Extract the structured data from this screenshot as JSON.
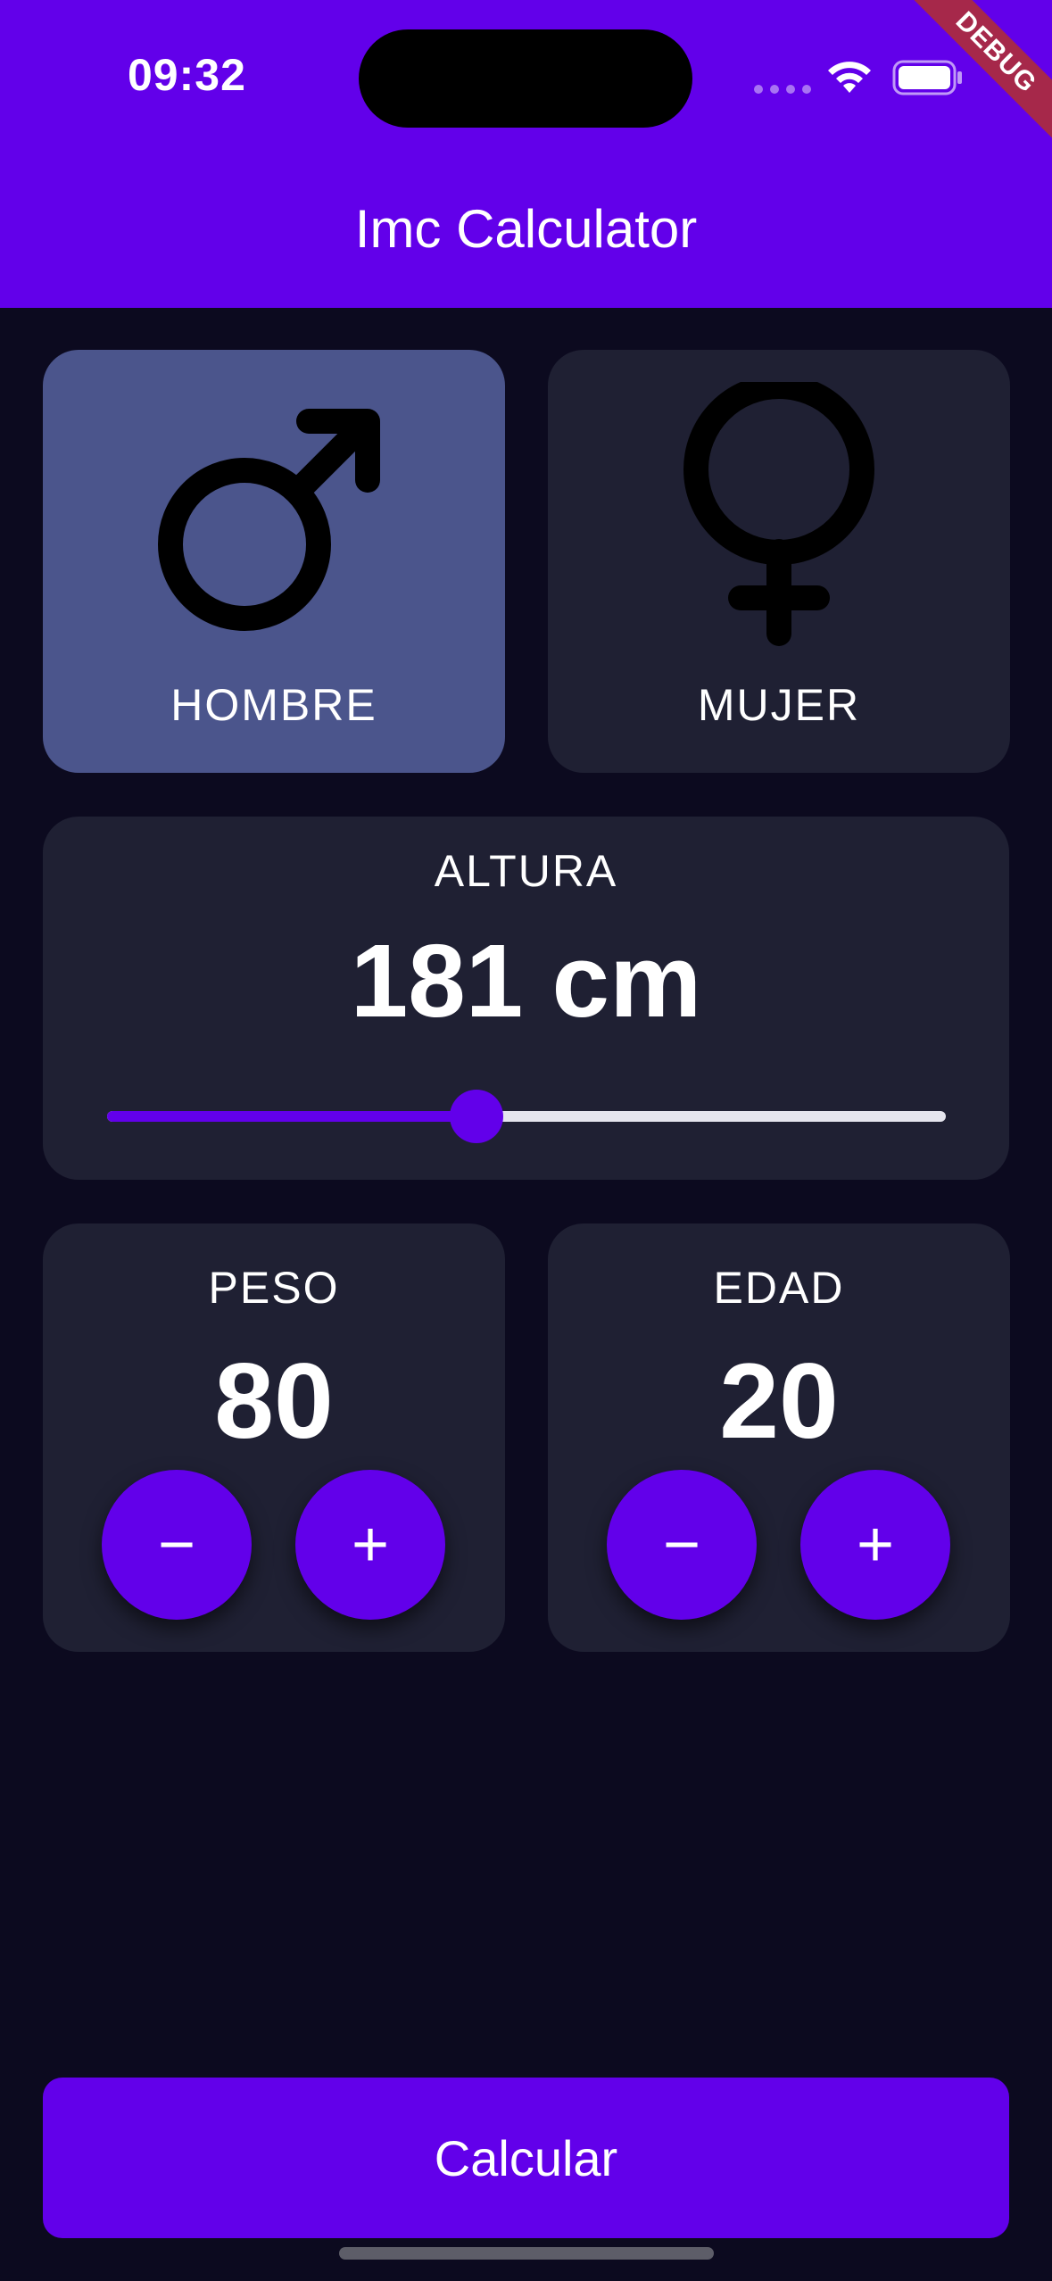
{
  "status_bar": {
    "time": "09:32",
    "debug_label": "DEBUG"
  },
  "app_bar": {
    "title": "Imc Calculator"
  },
  "gender": {
    "male": {
      "label": "HOMBRE",
      "icon": "male-icon",
      "selected": true
    },
    "female": {
      "label": "MUJER",
      "icon": "female-icon",
      "selected": false
    }
  },
  "height": {
    "label": "ALTURA",
    "value_text": "181 cm",
    "slider_fraction": 0.44
  },
  "weight": {
    "label": "PESO",
    "value": "80",
    "minus_label": "−",
    "plus_label": "+"
  },
  "age": {
    "label": "EDAD",
    "value": "20",
    "minus_label": "−",
    "plus_label": "+"
  },
  "calculate_button": {
    "label": "Calcular"
  },
  "colors": {
    "accent": "#6200ea",
    "background": "#0c0a1f",
    "card": "#1f2033",
    "card_selected": "#4b558c"
  }
}
